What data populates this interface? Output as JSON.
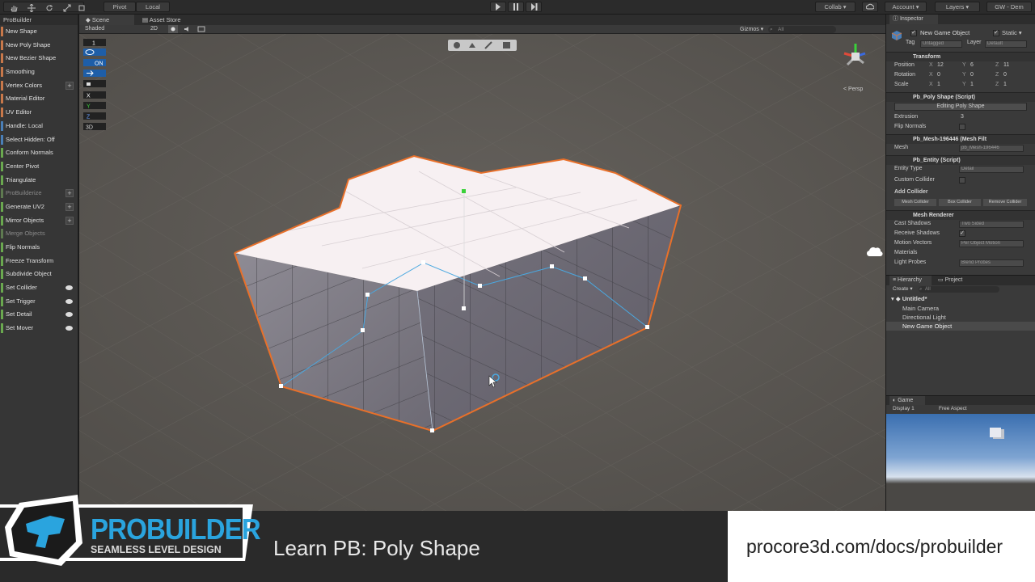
{
  "toolbar": {
    "pivot": "Pivot",
    "local": "Local",
    "collab": "Collab ▾",
    "account": "Account",
    "layers": "Layers",
    "layout": "GW - Dem"
  },
  "probuilder": {
    "title": "ProBuilder",
    "items": [
      {
        "label": "New Shape",
        "color": "#c8784a",
        "state": "on"
      },
      {
        "label": "New Poly Shape",
        "color": "#c8784a",
        "state": "on"
      },
      {
        "label": "New Bezier Shape",
        "color": "#c8784a",
        "state": "on"
      },
      {
        "label": "Smoothing",
        "color": "#c8784a",
        "state": "on"
      },
      {
        "label": "Vertex Colors",
        "color": "#c8784a",
        "state": "plus"
      },
      {
        "label": "Material Editor",
        "color": "#c8784a",
        "state": "on"
      },
      {
        "label": "UV Editor",
        "color": "#c8784a",
        "state": "on"
      },
      {
        "label": "Handle: Local",
        "color": "#4a7fb8",
        "state": "on"
      },
      {
        "label": "Select Hidden: Off",
        "color": "#4a7fb8",
        "state": "on"
      },
      {
        "label": "Conform Normals",
        "color": "#6aa84f",
        "state": "on"
      },
      {
        "label": "Center Pivot",
        "color": "#6aa84f",
        "state": "on"
      },
      {
        "label": "Triangulate",
        "color": "#6aa84f",
        "state": "on"
      },
      {
        "label": "ProBuilderize",
        "color": "#5e7a50",
        "state": "dis-plus"
      },
      {
        "label": "Generate UV2",
        "color": "#6aa84f",
        "state": "plus"
      },
      {
        "label": "Mirror Objects",
        "color": "#6aa84f",
        "state": "plus"
      },
      {
        "label": "Merge Objects",
        "color": "#5e7a50",
        "state": "dis"
      },
      {
        "label": "Flip Normals",
        "color": "#6aa84f",
        "state": "on"
      },
      {
        "label": "Freeze Transform",
        "color": "#6aa84f",
        "state": "on"
      },
      {
        "label": "Subdivide Object",
        "color": "#6aa84f",
        "state": "on"
      },
      {
        "label": "Set Collider",
        "color": "#6aa84f",
        "state": "eye"
      },
      {
        "label": "Set Trigger",
        "color": "#6aa84f",
        "state": "eye"
      },
      {
        "label": "Set Detail",
        "color": "#6aa84f",
        "state": "eye"
      },
      {
        "label": "Set Mover",
        "color": "#6aa84f",
        "state": "eye"
      }
    ]
  },
  "scene": {
    "tab_scene": "Scene",
    "tab_asset_store": "Asset Store",
    "shading": "Shaded",
    "mode_2d": "2D",
    "gizmos": "Gizmos",
    "search_placeholder": "All",
    "persp": "< Persp",
    "gizmo_axes": {
      "x": "x",
      "y": "y",
      "z": "z"
    },
    "overlay": {
      "level": "1",
      "toggle_on": "ON",
      "axis_x": "X",
      "axis_y": "Y",
      "axis_z": "Z",
      "view_3d": "3D"
    }
  },
  "inspector": {
    "tab": "Inspector",
    "object_name": "New Game Object",
    "static_label": "Static",
    "tag_label": "Tag",
    "tag_value": "Untagged",
    "layer_label": "Layer",
    "layer_value": "Default",
    "transform": {
      "title": "Transform",
      "position": {
        "label": "Position",
        "x": "12",
        "y": "6",
        "z": "11"
      },
      "rotation": {
        "label": "Rotation",
        "x": "0",
        "y": "0",
        "z": "0"
      },
      "scale": {
        "label": "Scale",
        "x": "1",
        "y": "1",
        "z": "1"
      }
    },
    "poly_shape": {
      "title": "Pb_Poly Shape (Script)",
      "editing_button": "Editing Poly Shape",
      "extrusion_label": "Extrusion",
      "extrusion_value": "3",
      "flip_normals_label": "Flip Normals"
    },
    "mesh_filter": {
      "title": "Pb_Mesh-196446 (Mesh Filt",
      "mesh_label": "Mesh",
      "mesh_value": "pb_Mesh-196446"
    },
    "entity": {
      "title": "Pb_Entity (Script)",
      "entity_type_label": "Entity Type",
      "entity_type_value": "Detail",
      "custom_collider_label": "Custom Collider",
      "add_collider_label": "Add Collider",
      "mesh_collider": "Mesh Collider",
      "box_collider": "Box Collider",
      "remove_collider": "Remove Collider"
    },
    "mesh_renderer": {
      "title": "Mesh Renderer",
      "cast_shadows_label": "Cast Shadows",
      "cast_shadows_value": "Two Sided",
      "receive_shadows_label": "Receive Shadows",
      "motion_vectors_label": "Motion Vectors",
      "motion_vectors_value": "Per Object Motion",
      "materials_label": "Materials",
      "light_probes_label": "Light Probes",
      "light_probes_value": "Blend Probes"
    }
  },
  "hierarchy": {
    "tab_hierarchy": "Hierarchy",
    "tab_project": "Project",
    "create": "Create ▾",
    "search_placeholder": "All",
    "scene_name": "Untitled*",
    "items": [
      "Main Camera",
      "Directional Light",
      "New Game Object"
    ]
  },
  "game": {
    "tab": "Game",
    "display": "Display 1",
    "aspect": "Free Aspect"
  },
  "banner": {
    "logo_title": "PROBUILDER",
    "logo_subtitle": "SEAMLESS LEVEL DESIGN",
    "lesson_title": "Learn PB: Poly Shape",
    "url": "procore3d.com/docs/probuilder"
  },
  "colors": {
    "selection_outline": "#e8702a",
    "vertex_handle": "#ffffff",
    "guide_line": "#4aa8e0",
    "accent_green": "#3ad13a",
    "logo_blue": "#2aa4de"
  }
}
